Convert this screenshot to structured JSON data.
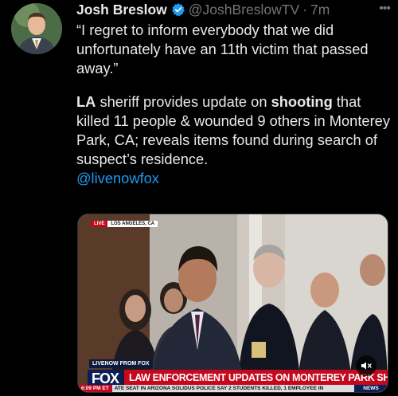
{
  "tweet": {
    "author_name": "Josh Breslow",
    "handle": "@JoshBreslowTV",
    "separator": "·",
    "time": "7m",
    "more_label": "•••",
    "quote": "“I regret to inform everybody that we did unfortunately have an 11th victim that passed away.”",
    "p2_part1": "LA",
    "p2_part2": " sheriff provides update on ",
    "p2_part3": "shooting",
    "p2_part4": " that killed 11 people & wounded 9 others in Monterey Park, CA; reveals items found during search of suspect’s residence.",
    "mention": "@livenowfox"
  },
  "video": {
    "live_label": "LIVE",
    "location": "LOS ANGELES, CA",
    "source": "LIVENOW FROM FOX",
    "network": "FOX",
    "headline": "LAW ENFORCEMENT UPDATES ON MONTEREY PARK SHOOTING",
    "ticker_time": "6:09 PM ET",
    "ticker_text": "ATE SEAT IN ARIZONA  SOLIDUS  POLICE SAY 2 STUDENTS KILLED, 1 EMPLOYEE IN",
    "ticker_news": "NEWS"
  },
  "colors": {
    "link": "#1d9bf0",
    "muted": "#71767b",
    "verified": "#1d9bf0",
    "fox_red": "#c5081c",
    "fox_blue": "#0b1e57"
  },
  "icons": [
    "verified-badge-icon",
    "more-options-icon",
    "mute-icon"
  ]
}
